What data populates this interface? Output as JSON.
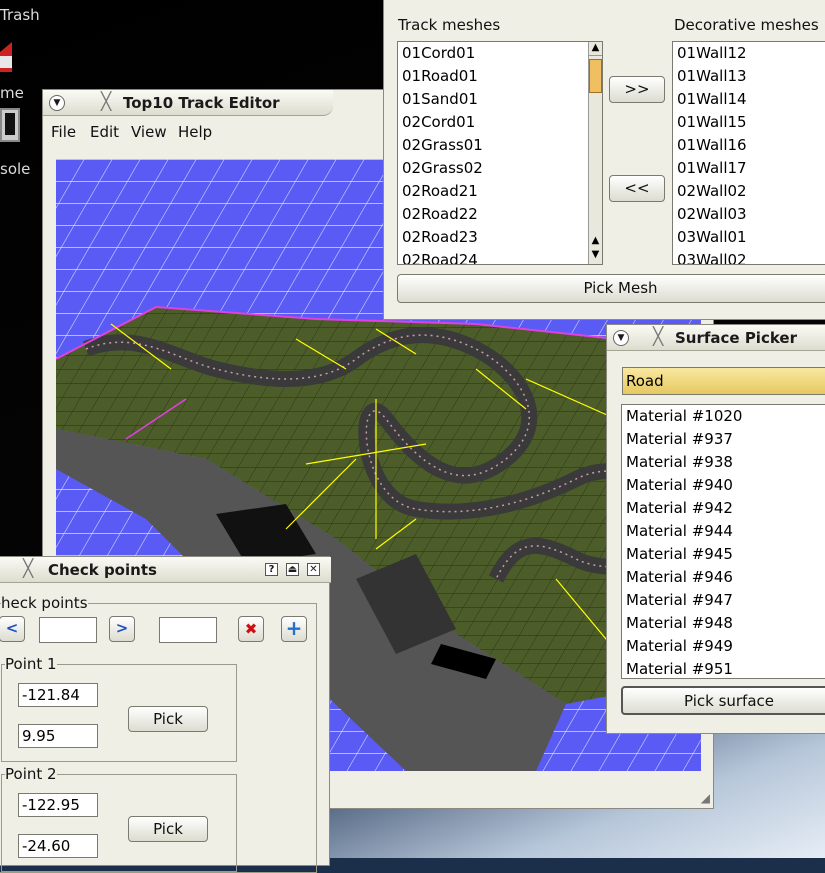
{
  "desktop": {
    "icons": [
      {
        "label": "Trash"
      },
      {
        "label": "me"
      },
      {
        "label": "sole"
      }
    ]
  },
  "editor": {
    "title": "Top10 Track Editor",
    "menu": [
      "File",
      "Edit",
      "View",
      "Help"
    ]
  },
  "meshes": {
    "track_label": "Track meshes",
    "decor_label": "Decorative meshes",
    "track_items": [
      "01Cord01",
      "01Road01",
      "01Sand01",
      "02Cord01",
      "02Grass01",
      "02Grass02",
      "02Road21",
      "02Road22",
      "02Road23",
      "02Road24"
    ],
    "decor_items": [
      "01Wall12",
      "01Wall13",
      "01Wall14",
      "01Wall15",
      "01Wall16",
      "01Wall17",
      "02Wall02",
      "02Wall03",
      "03Wall01",
      "03Wall02"
    ],
    "add_label": ">>",
    "remove_label": "<<",
    "pick_label": "Pick Mesh"
  },
  "surface": {
    "title": "Surface Picker",
    "selected": "Road",
    "items": [
      "Material #1020",
      "Material #937",
      "Material #938",
      "Material #940",
      "Material #942",
      "Material #944",
      "Material #945",
      "Material #946",
      "Material #947",
      "Material #948",
      "Material #949",
      "Material #951"
    ],
    "pick_label": "Pick surface"
  },
  "checkpoints": {
    "title": "Check points",
    "group_label": "heck points",
    "point1": {
      "label": "Point 1",
      "x": "-121.84",
      "y": "9.95",
      "pick": "Pick"
    },
    "point2": {
      "label": "Point 2",
      "x": "-122.95",
      "y": "-24.60",
      "pick": "Pick"
    },
    "help_glyph": "?"
  },
  "colors": {
    "grid": "#5a5af5",
    "grass": "#4d5d2a",
    "road": "#444"
  }
}
